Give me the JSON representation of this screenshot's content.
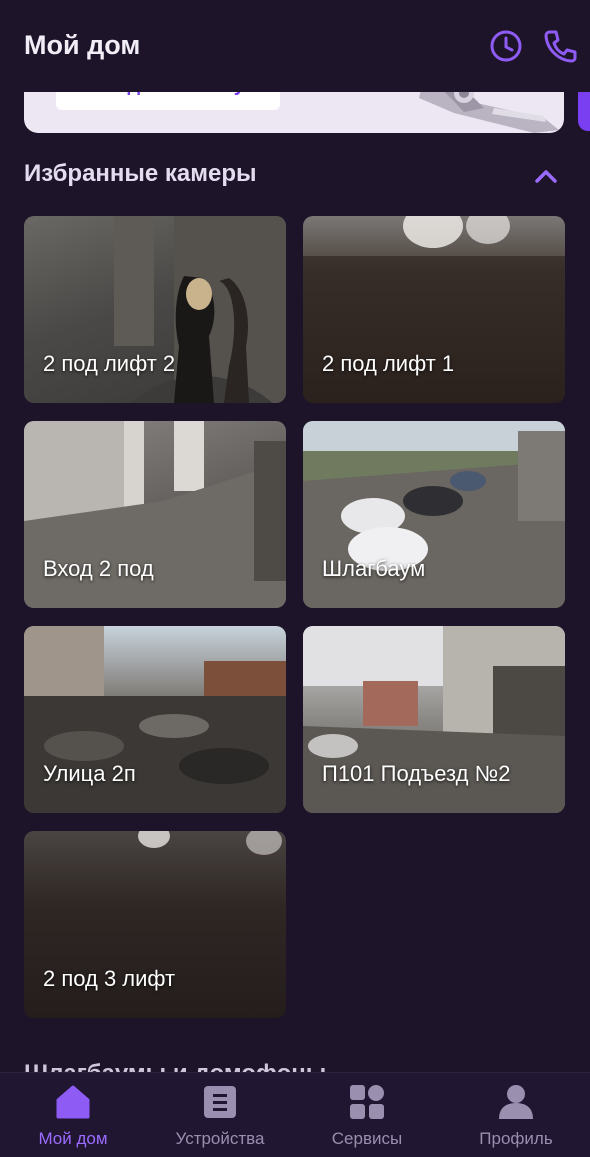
{
  "header": {
    "title": "Мой дом"
  },
  "banner": {
    "button_label": "Создать заявку"
  },
  "favorites": {
    "title": "Избранные камеры"
  },
  "cameras": [
    {
      "label": "2 под лифт 2"
    },
    {
      "label": "2 под лифт 1"
    },
    {
      "label": "Вход 2 под"
    },
    {
      "label": "Шлагбаум"
    },
    {
      "label": "Улица 2п"
    },
    {
      "label": "П101 Подъезд №2"
    },
    {
      "label": "2 под 3 лифт"
    }
  ],
  "next_section": {
    "title": "Шлагбаумы и домофоны"
  },
  "tabs": [
    {
      "label": "Мой дом"
    },
    {
      "label": "Устройства"
    },
    {
      "label": "Сервисы"
    },
    {
      "label": "Профиль"
    }
  ],
  "colors": {
    "accent": "#9b6bff",
    "background": "#1d1429",
    "tab_inactive": "#9a8fae"
  }
}
